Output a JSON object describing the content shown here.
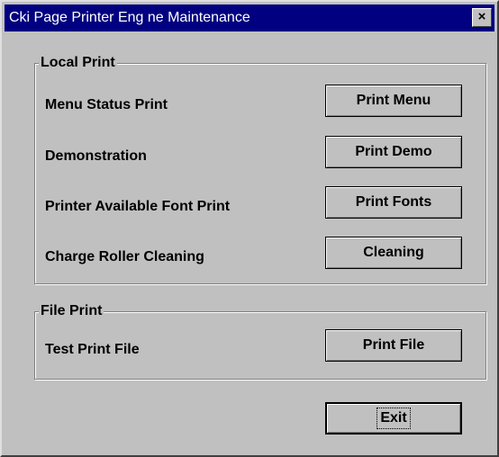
{
  "window": {
    "title": "Cki Page Printer Eng ne Maintenance",
    "close_glyph": "×"
  },
  "local_print": {
    "legend": "Local Print",
    "rows": [
      {
        "label": "Menu Status Print",
        "button": "Print Menu"
      },
      {
        "label": "Demonstration",
        "button": "Print Demo"
      },
      {
        "label": "Printer Available Font Print",
        "button": "Print Fonts"
      },
      {
        "label": "Charge Roller Cleaning",
        "button": "Cleaning"
      }
    ]
  },
  "file_print": {
    "legend": "File Print",
    "rows": [
      {
        "label": "Test Print File",
        "button": "Print File"
      }
    ]
  },
  "footer": {
    "exit_label": "Exit"
  },
  "colors": {
    "titlebar": "#000080",
    "face": "#c0c0c0"
  }
}
